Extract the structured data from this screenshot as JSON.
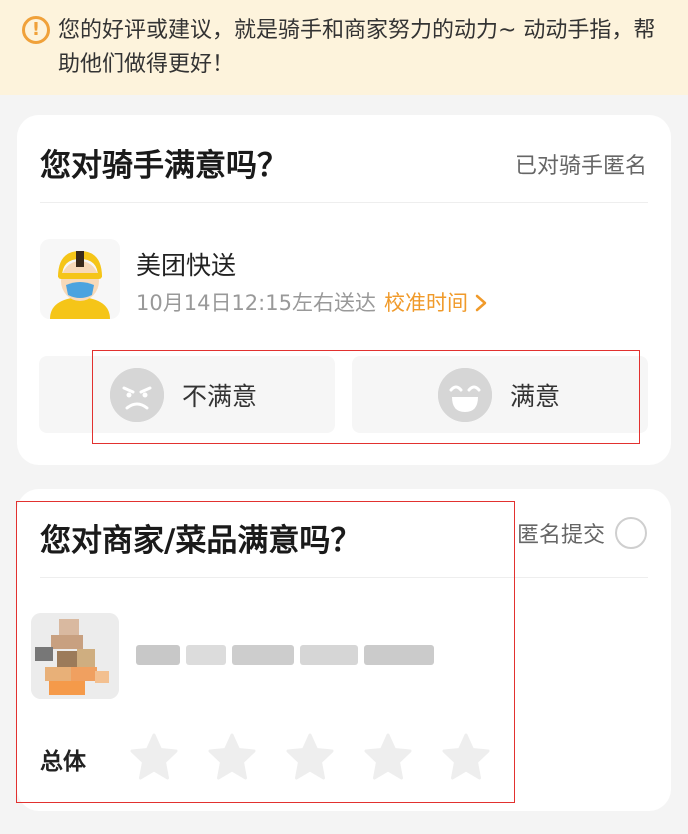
{
  "notice": {
    "icon": "exclamation-circle-icon",
    "text": "您的好评或建议，就是骑手和商家努力的动力~ 动动手指，帮助他们做得更好！"
  },
  "rider_card": {
    "title": "您对骑手满意吗？",
    "anonymous_label": "已对骑手匿名",
    "rider_name": "美团快送",
    "delivery_time": "10月14日12:15左右送达",
    "calibrate_link": "校准时间",
    "calibrate_icon": "chevron-right-icon",
    "dissatisfied_label": "不满意",
    "satisfied_label": "满意"
  },
  "merchant_card": {
    "title": "您对商家/菜品满意吗？",
    "anonymous_label": "匿名提交",
    "anonymous_checked": false,
    "overall_label": "总体",
    "star_count": 5,
    "rating": 0
  },
  "colors": {
    "accent": "#f09a2a",
    "notice_bg": "#fdf3dc",
    "star_empty": "#eeeeee",
    "annotation_box": "#e2312f"
  }
}
